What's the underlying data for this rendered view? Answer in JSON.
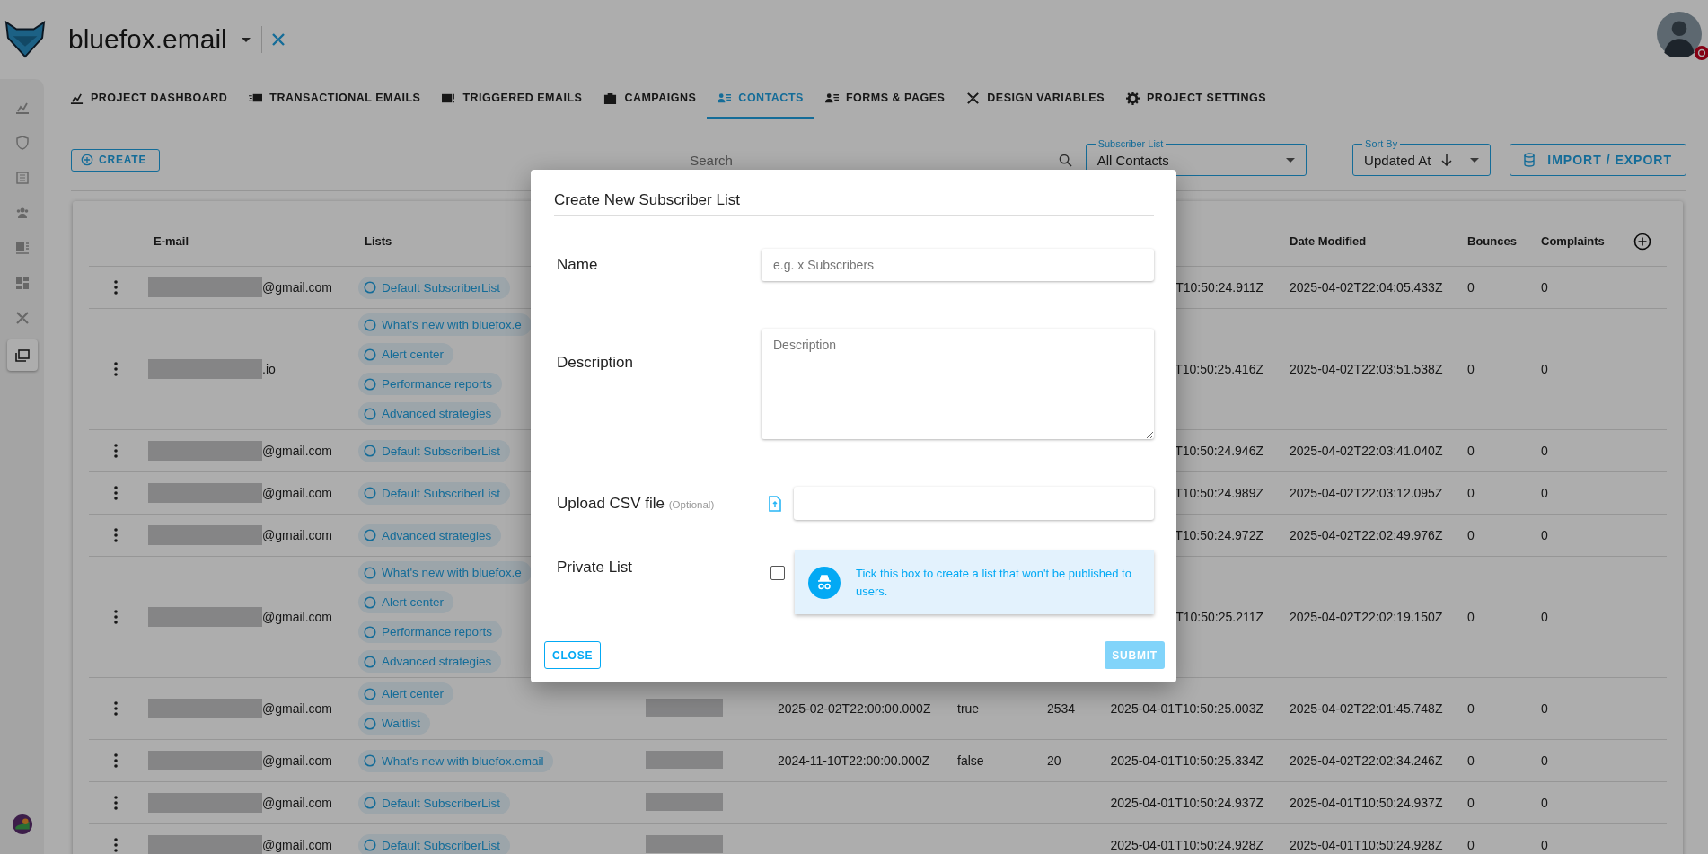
{
  "project": {
    "title": "bluefox.email"
  },
  "sidebar_items": [
    {
      "selected": false
    },
    {
      "selected": false
    },
    {
      "selected": false
    },
    {
      "selected": false
    },
    {
      "selected": false
    },
    {
      "selected": false
    },
    {
      "selected": false
    },
    {
      "selected": true
    }
  ],
  "tabs": [
    {
      "label": "PROJECT DASHBOARD",
      "selected": false
    },
    {
      "label": "TRANSACTIONAL EMAILS",
      "selected": false
    },
    {
      "label": "TRIGGERED EMAILS",
      "selected": false
    },
    {
      "label": "CAMPAIGNS",
      "selected": false
    },
    {
      "label": "CONTACTS",
      "selected": true
    },
    {
      "label": "FORMS & PAGES",
      "selected": false
    },
    {
      "label": "DESIGN VARIABLES",
      "selected": false
    },
    {
      "label": "PROJECT SETTINGS",
      "selected": false
    }
  ],
  "toolbar": {
    "create": "CREATE",
    "search": {
      "placeholder": "Search"
    },
    "subscriber_list": {
      "label": "Subscriber List",
      "value": "All Contacts"
    },
    "sort_by": {
      "label": "Sort By",
      "value": "Updated At"
    },
    "import_export": "IMPORT / EXPORT"
  },
  "table": {
    "columns": {
      "email": "E-mail",
      "lists": "Lists",
      "date_modified": "Date Modified",
      "bounces": "Bounces",
      "complaints": "Complaints"
    },
    "rows": [
      {
        "email_suffix": "@gmail.com",
        "lists": [
          "Default SubscriberList"
        ],
        "column_5": "",
        "column_6": "",
        "column_7": "",
        "created": "T10:50:24.911Z",
        "date_modified": "2025-04-02T22:04:05.433Z",
        "bounces": "0",
        "complaints": "0"
      },
      {
        "email_suffix": ".io",
        "lists": [
          "What's new with bluefox.e",
          "Alert center",
          "Performance reports",
          "Advanced strategies"
        ],
        "column_5": "",
        "column_6": "",
        "column_7": "",
        "created": "T10:50:25.416Z",
        "date_modified": "2025-04-02T22:03:51.538Z",
        "bounces": "0",
        "complaints": "0"
      },
      {
        "email_suffix": "@gmail.com",
        "lists": [
          "Default SubscriberList"
        ],
        "column_5": "",
        "column_6": "",
        "column_7": "",
        "created": "T10:50:24.946Z",
        "date_modified": "2025-04-02T22:03:41.040Z",
        "bounces": "0",
        "complaints": "0"
      },
      {
        "email_suffix": "@gmail.com",
        "lists": [
          "Default SubscriberList"
        ],
        "column_5": "",
        "column_6": "",
        "column_7": "",
        "created": "T10:50:24.989Z",
        "date_modified": "2025-04-02T22:03:12.095Z",
        "bounces": "0",
        "complaints": "0"
      },
      {
        "email_suffix": "@gmail.com",
        "lists": [
          "Advanced strategies"
        ],
        "column_5": "",
        "column_6": "",
        "column_7": "",
        "created": "T10:50:24.972Z",
        "date_modified": "2025-04-02T22:02:49.976Z",
        "bounces": "0",
        "complaints": "0"
      },
      {
        "email_suffix": "@gmail.com",
        "lists": [
          "What's new with bluefox.e",
          "Alert center",
          "Performance reports",
          "Advanced strategies"
        ],
        "column_5": "",
        "column_6": "",
        "column_7": "",
        "created": "T10:50:25.211Z",
        "date_modified": "2025-04-02T22:02:19.150Z",
        "bounces": "0",
        "complaints": "0"
      },
      {
        "email_suffix": "@gmail.com",
        "lists": [
          "Alert center",
          "Waitlist"
        ],
        "column_4_redacted": true,
        "column_5": "2025-02-02T22:00:00.000Z",
        "column_6": "true",
        "column_7": "2534",
        "created": "2025-04-01T10:50:25.003Z",
        "date_modified": "2025-04-02T22:01:45.748Z",
        "bounces": "0",
        "complaints": "0"
      },
      {
        "email_suffix": "@gmail.com",
        "lists": [
          "What's new with bluefox.email"
        ],
        "column_4_redacted": true,
        "column_5": "2024-11-10T22:00:00.000Z",
        "column_6": "false",
        "column_7": "20",
        "created": "2025-04-01T10:50:25.334Z",
        "date_modified": "2025-04-02T22:02:34.246Z",
        "bounces": "0",
        "complaints": "0"
      },
      {
        "email_suffix": "@gmail.com",
        "lists": [
          "Default SubscriberList"
        ],
        "column_4_redacted": true,
        "column_5": "",
        "column_6": "",
        "column_7": "",
        "created": "2025-04-01T10:50:24.937Z",
        "date_modified": "2025-04-01T10:50:24.937Z",
        "bounces": "0",
        "complaints": "0"
      },
      {
        "email_suffix": "@gmail.com",
        "lists": [
          "Default SubscriberList"
        ],
        "column_4_redacted": true,
        "column_5": "",
        "column_6": "",
        "column_7": "",
        "created": "2025-04-01T10:50:24.928Z",
        "date_modified": "2025-04-01T10:50:24.928Z",
        "bounces": "0",
        "complaints": "0"
      }
    ]
  },
  "dialog": {
    "title": "Create New Subscriber List",
    "name": {
      "label": "Name",
      "placeholder": "e.g. x Subscribers"
    },
    "description": {
      "label": "Description",
      "placeholder": "Description"
    },
    "upload": {
      "label": "Upload CSV file",
      "hint": "(Optional)"
    },
    "private_list": {
      "label": "Private List",
      "checked": false,
      "info": "Tick this box to create a list that won't be published to users."
    },
    "close": "CLOSE",
    "submit": {
      "label": "SUBMIT",
      "disabled": true
    }
  }
}
